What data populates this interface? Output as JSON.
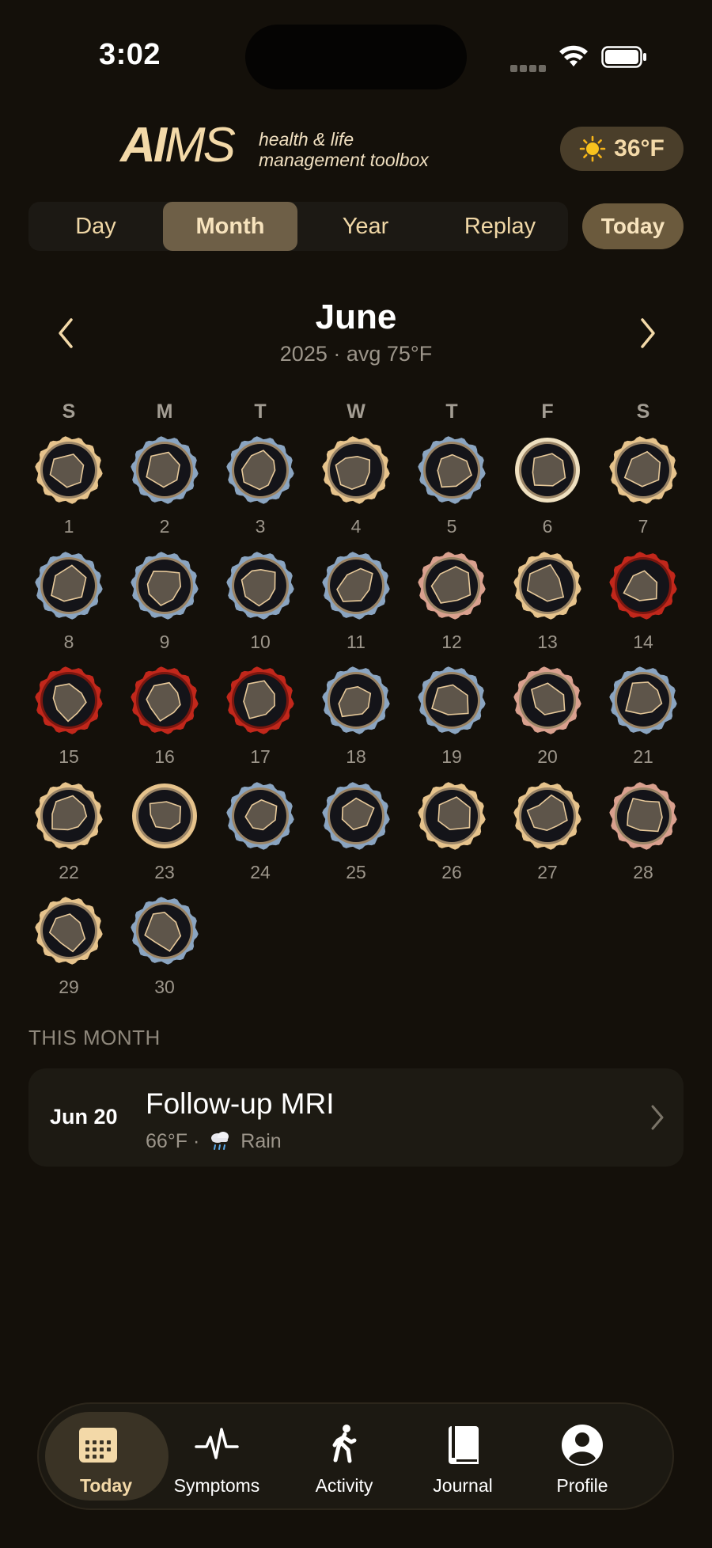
{
  "status_bar": {
    "time": "3:02"
  },
  "header": {
    "logo_ai": "AI",
    "logo_ms": "MS",
    "tagline_line1": "health & life",
    "tagline_line2": "management toolbox",
    "weather_temp": "36°F",
    "weather_icon": "sun-icon"
  },
  "view_tabs": [
    "Day",
    "Month",
    "Year",
    "Replay"
  ],
  "active_view": "Month",
  "today_button": "Today",
  "month": {
    "name": "June",
    "subtitle": "2025 · avg 75°F"
  },
  "weekdays": [
    "S",
    "M",
    "T",
    "W",
    "T",
    "F",
    "S"
  ],
  "days": [
    {
      "n": "1",
      "ring": "gold"
    },
    {
      "n": "2",
      "ring": "blue"
    },
    {
      "n": "3",
      "ring": "blue"
    },
    {
      "n": "4",
      "ring": "gold"
    },
    {
      "n": "5",
      "ring": "blue"
    },
    {
      "n": "6",
      "ring": "cream"
    },
    {
      "n": "7",
      "ring": "gold"
    },
    {
      "n": "8",
      "ring": "blue"
    },
    {
      "n": "9",
      "ring": "blue"
    },
    {
      "n": "10",
      "ring": "blue"
    },
    {
      "n": "11",
      "ring": "blue"
    },
    {
      "n": "12",
      "ring": "pink"
    },
    {
      "n": "13",
      "ring": "gold"
    },
    {
      "n": "14",
      "ring": "red"
    },
    {
      "n": "15",
      "ring": "red"
    },
    {
      "n": "16",
      "ring": "red"
    },
    {
      "n": "17",
      "ring": "red"
    },
    {
      "n": "18",
      "ring": "blue"
    },
    {
      "n": "19",
      "ring": "blue"
    },
    {
      "n": "20",
      "ring": "pink"
    },
    {
      "n": "21",
      "ring": "blue"
    },
    {
      "n": "22",
      "ring": "gold"
    },
    {
      "n": "23",
      "ring": "gold"
    },
    {
      "n": "24",
      "ring": "blue"
    },
    {
      "n": "25",
      "ring": "blue"
    },
    {
      "n": "26",
      "ring": "gold"
    },
    {
      "n": "27",
      "ring": "gold"
    },
    {
      "n": "28",
      "ring": "pink"
    },
    {
      "n": "29",
      "ring": "gold"
    },
    {
      "n": "30",
      "ring": "blue"
    }
  ],
  "ring_colors": {
    "gold": "#e6c38c",
    "blue": "#8aa4c0",
    "cream": "#efe0c0",
    "pink": "#d9a08e",
    "red": "#c1271b"
  },
  "this_month": {
    "label": "THIS MONTH",
    "events": [
      {
        "date": "Jun 20",
        "title": "Follow-up MRI",
        "temp": "66°F ·",
        "weather_icon": "rain-cloud-icon",
        "condition": "Rain"
      }
    ]
  },
  "tab_bar": {
    "active": "Today",
    "items": [
      {
        "label": "Today",
        "icon": "calendar-icon"
      },
      {
        "label": "Symptoms",
        "icon": "pulse-icon"
      },
      {
        "label": "Activity",
        "icon": "walking-figure-icon"
      },
      {
        "label": "Journal",
        "icon": "book-icon"
      },
      {
        "label": "Profile",
        "icon": "person-circle-icon"
      }
    ]
  },
  "colors": {
    "background": "#14100a",
    "accent": "#f3d9a8",
    "active_segment": "#6e5f47"
  }
}
